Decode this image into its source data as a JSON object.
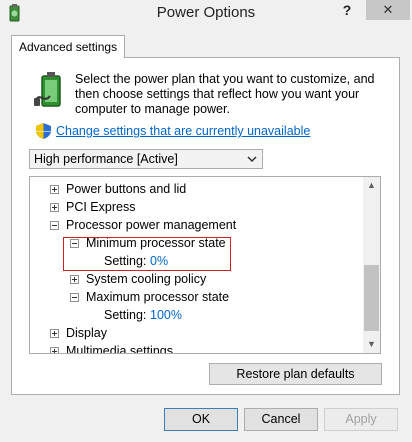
{
  "window": {
    "title": "Power Options",
    "help_label": "?",
    "close_label": "✕"
  },
  "tab": {
    "label": "Advanced settings"
  },
  "intro": {
    "text": "Select the power plan that you want to customize, and then choose settings that reflect how you want your computer to manage power."
  },
  "link": {
    "label": "Change settings that are currently unavailable"
  },
  "plan": {
    "selected": "High performance [Active]"
  },
  "tree": {
    "items": {
      "power_buttons": "Power buttons and lid",
      "pci_express": "PCI Express",
      "processor_power": "Processor power management",
      "min_state": "Minimum processor state",
      "min_setting_label": "Setting:",
      "min_setting_value": "0%",
      "cooling": "System cooling policy",
      "max_state": "Maximum processor state",
      "max_setting_label": "Setting:",
      "max_setting_value": "100%",
      "display": "Display",
      "multimedia": "Multimedia settings"
    }
  },
  "buttons": {
    "restore": "Restore plan defaults",
    "ok": "OK",
    "cancel": "Cancel",
    "apply": "Apply"
  },
  "colors": {
    "link": "#0066cc",
    "highlight": "#d02020",
    "close_button_bg": "#c7c7c7"
  }
}
